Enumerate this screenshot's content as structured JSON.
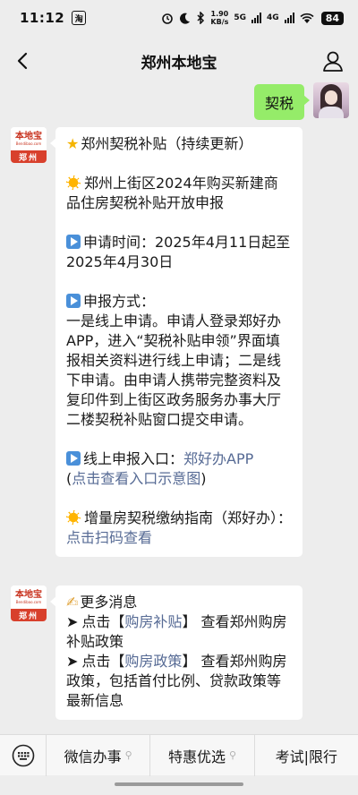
{
  "status": {
    "time": "11:12",
    "app_badge": "淘",
    "speed_value": "1.90",
    "speed_unit": "KB/s",
    "net_5g": "5G",
    "net_4g": "4G",
    "battery": "84"
  },
  "nav": {
    "title": "郑州本地宝"
  },
  "user_message": {
    "text": "契税"
  },
  "brand": {
    "logo_cn": "本地宝",
    "logo_en": "Bendibao.com",
    "city": "郑州"
  },
  "message1": {
    "title": "郑州契税补贴（持续更新）",
    "headline": "郑州上街区2024年购买新建商品住房契税补贴开放申报",
    "time_label": "申请时间：2025年4月11日起至2025年4月30日",
    "method_heading": "申报方式：",
    "method_text": "一是线上申请。申请人登录郑好办APP，进入“契税补贴申领”界面填报相关资料进行线上申请；二是线下申请。由申请人携带完整资料及复印件到上街区政务服务办事大厅二楼契税补贴窗口提交申请。",
    "online_label": "线上申报入口：",
    "online_link": "郑好办APP",
    "online_paren_open": "(",
    "online_view_link": "点击查看入口示意图",
    "online_paren_close": ")",
    "guide_text": "增量房契税缴纳指南（郑好办）：",
    "guide_link": "点击扫码查看"
  },
  "message2": {
    "heading": "更多消息",
    "line1_prefix": "点击【",
    "line1_link": "购房补贴",
    "line1_suffix": "】 查看郑州购房补贴政策",
    "line2_prefix": "点击【",
    "line2_link": "购房政策",
    "line2_suffix": "】 查看郑州购房政策，包括首付比例、贷款政策等最新信息"
  },
  "menu": {
    "items": [
      {
        "label": "微信办事"
      },
      {
        "label": "特惠优选"
      },
      {
        "label": "考试|限行"
      }
    ]
  }
}
